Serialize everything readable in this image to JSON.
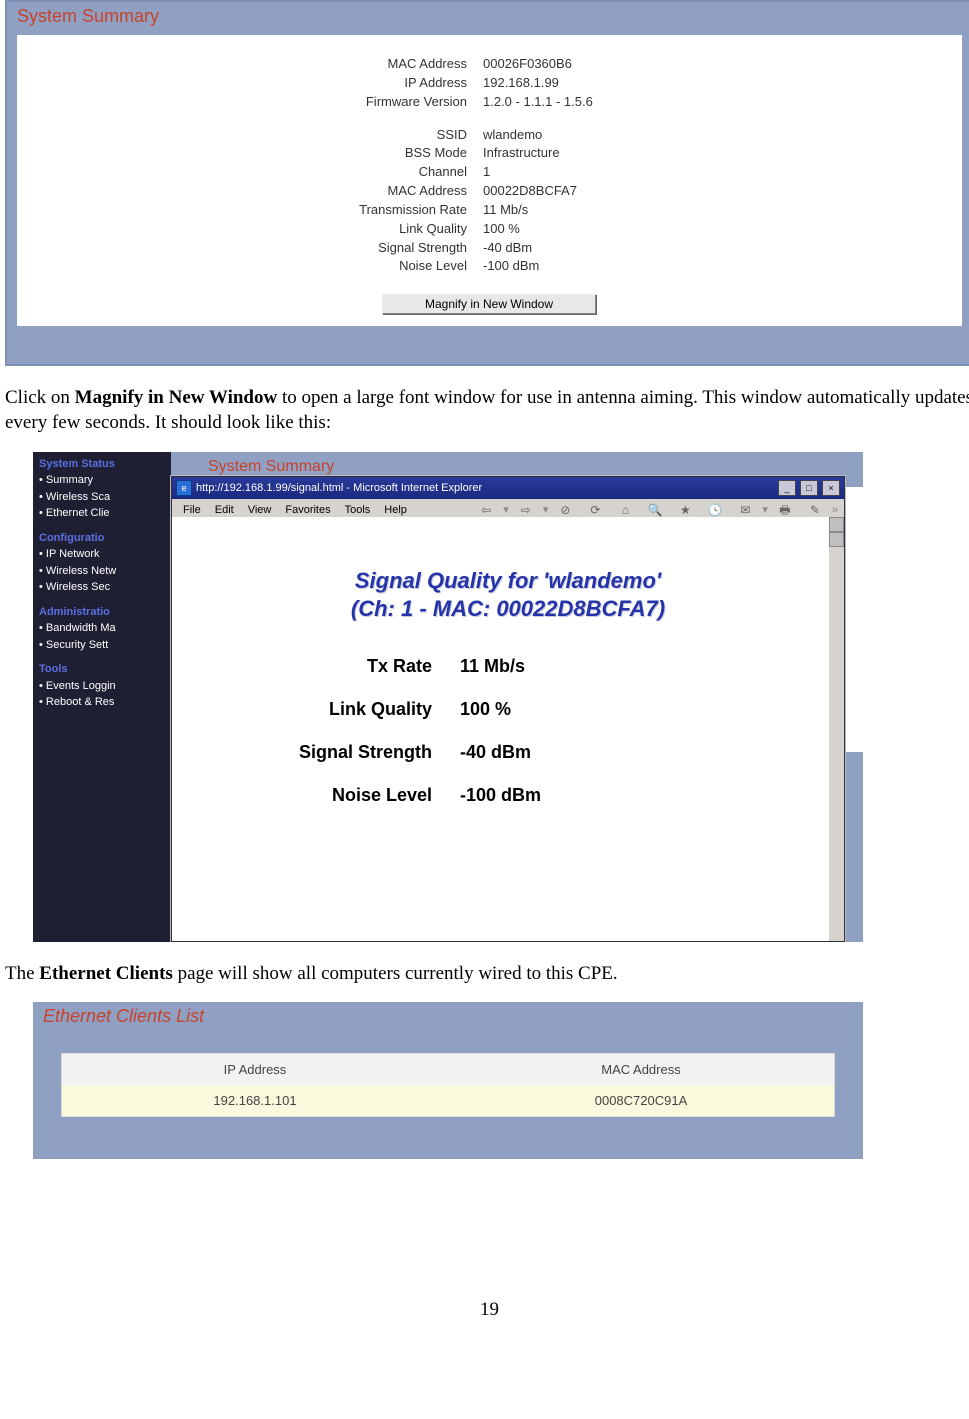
{
  "summary": {
    "title": "System Summary",
    "rows1": [
      {
        "k": "MAC Address",
        "v": "00026F0360B6"
      },
      {
        "k": "IP Address",
        "v": "192.168.1.99"
      },
      {
        "k": "Firmware Version",
        "v": "1.2.0 - 1.1.1 - 1.5.6"
      }
    ],
    "rows2": [
      {
        "k": "SSID",
        "v": "wlandemo"
      },
      {
        "k": "BSS Mode",
        "v": "Infrastructure"
      },
      {
        "k": "Channel",
        "v": "1"
      },
      {
        "k": "MAC Address",
        "v": "00022D8BCFA7"
      },
      {
        "k": "Transmission Rate",
        "v": "11 Mb/s"
      },
      {
        "k": "Link Quality",
        "v": "100 %"
      },
      {
        "k": "Signal Strength",
        "v": "-40 dBm"
      },
      {
        "k": "Noise Level",
        "v": "-100 dBm"
      }
    ],
    "button": "Magnify in New Window"
  },
  "para1": {
    "pre": "Click on ",
    "b": "Magnify in New Window",
    "post": " to open a large font window for use in antenna aiming.  This window automatically updates every few seconds.  It should look like this:"
  },
  "nav": {
    "g1": "System Status",
    "i1": "Summary",
    "i2": "Wireless Sca",
    "i3": "Ethernet Clie",
    "g2": "Configuratio",
    "i4": "IP Network",
    "i5": "Wireless Netw",
    "i6": "Wireless Sec",
    "g3": "Administratio",
    "i7": "Bandwidth Ma",
    "i8": "Security Sett",
    "g4": "Tools",
    "i9": "Events Loggin",
    "i10": "Reboot & Res"
  },
  "shot2": {
    "pageTitle": "System Summary",
    "ieTitle": "http://192.168.1.99/signal.html - Microsoft Internet Explorer",
    "menu": {
      "file": "File",
      "edit": "Edit",
      "view": "View",
      "fav": "Favorites",
      "tools": "Tools",
      "help": "Help"
    },
    "h1": "Signal Quality for 'wlandemo'",
    "h2": "(Ch: 1 - MAC: 00022D8BCFA7)",
    "rows": [
      {
        "l": "Tx Rate",
        "r": "11 Mb/s"
      },
      {
        "l": "Link Quality",
        "r": "100 %"
      },
      {
        "l": "Signal Strength",
        "r": "-40 dBm"
      },
      {
        "l": "Noise Level",
        "r": "-100 dBm"
      }
    ]
  },
  "para2": {
    "pre": "The ",
    "b": "Ethernet Clients",
    "post": " page will show all computers currently wired to this CPE."
  },
  "eth": {
    "title": "Ethernet Clients List",
    "h1": "IP Address",
    "h2": "MAC Address",
    "r1c1": "192.168.1.101",
    "r1c2": "0008C720C91A"
  },
  "pagenum": "19"
}
